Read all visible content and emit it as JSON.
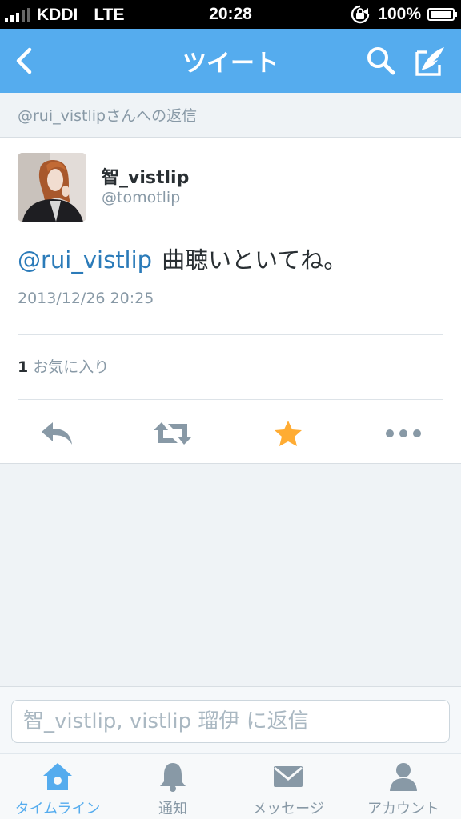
{
  "status_bar": {
    "carrier": "KDDI",
    "network": "LTE",
    "time": "20:28",
    "battery": "100%"
  },
  "nav": {
    "title": "ツイート",
    "icons": [
      "back-arrow-icon",
      "search-icon",
      "compose-icon"
    ],
    "color": "#55acee"
  },
  "reply_banner": {
    "text": "@rui_vistlipさんへの返信"
  },
  "tweet": {
    "display_name": "智_vistlip",
    "handle": "@tomotlip",
    "mention": "@rui_vistlip",
    "body": "曲聴いといてね。",
    "timestamp": "2013/12/26 20:25",
    "favorites_count": "1",
    "favorites_label": "お気に入り",
    "actions": [
      "reply-icon",
      "retweet-icon",
      "favorite-star-icon",
      "more-icon"
    ],
    "favorited": true,
    "star_color": "#ffac33",
    "link_color": "#2b7bb9"
  },
  "reply_input": {
    "placeholder": "智_vistlip, vistlip 瑠伊 に返信"
  },
  "tabs": [
    {
      "label": "タイムライン",
      "icon": "home-icon",
      "active": true
    },
    {
      "label": "通知",
      "icon": "bell-icon",
      "active": false
    },
    {
      "label": "メッセージ",
      "icon": "envelope-icon",
      "active": false
    },
    {
      "label": "アカウント",
      "icon": "person-icon",
      "active": false
    }
  ]
}
